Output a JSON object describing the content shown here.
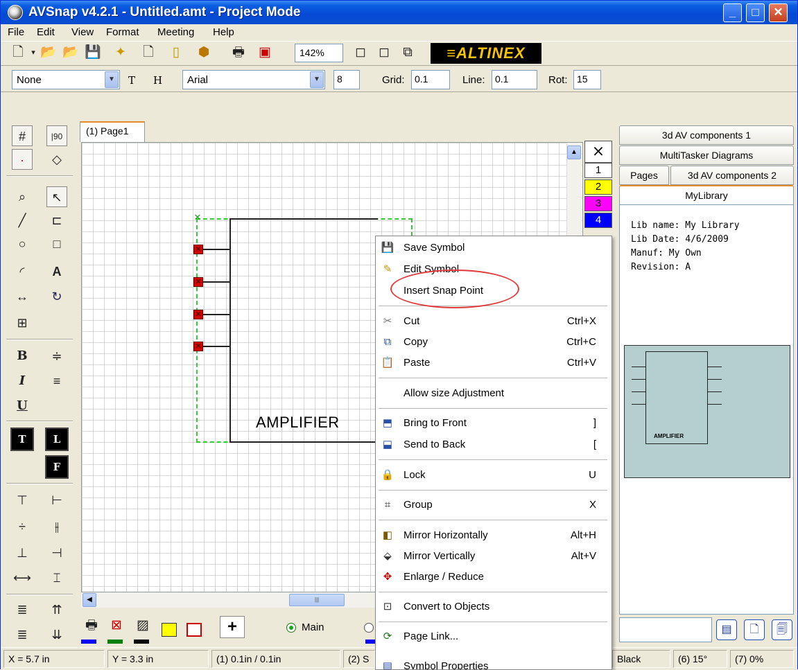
{
  "window": {
    "title": "AVSnap v4.2.1 - Untitled.amt  - Project Mode"
  },
  "menu": [
    "File",
    "Edit",
    "View",
    "Format",
    "Meeting",
    "Help"
  ],
  "toolbar": {
    "zoom": "142%",
    "logo": "≡ALTINEX"
  },
  "format_bar": {
    "style": "None",
    "bold_t": "T",
    "bold_h": "H",
    "font": "Arial",
    "font_size": "8",
    "grid_label": "Grid:",
    "grid_value": "0.1",
    "line_label": "Line:",
    "line_value": "0.1",
    "rot_label": "Rot:",
    "rot_value": "15"
  },
  "left_tools": {
    "angle": "|90",
    "text_a": "A",
    "bold": "B",
    "italic": "I",
    "underline": "U",
    "t": "T",
    "l": "L",
    "f": "F"
  },
  "page_tab": "(1) Page1",
  "canvas": {
    "symbol_label": "AMPLIFIER"
  },
  "layers": [
    "1",
    "2",
    "3",
    "4"
  ],
  "palette": {
    "main_label": "Main",
    "add": "+"
  },
  "status": [
    "X = 5.7 in",
    "Y = 3.3 in",
    "(1) 0.1in / 0.1in",
    "(2) S",
    "Black",
    "(6) 15°",
    "(7) 0%"
  ],
  "right_panel": {
    "tabs": [
      "3d AV components 1",
      "MultiTasker Diagrams",
      "Pages",
      "3d AV components 2",
      "MyLibrary"
    ],
    "lib_name": "Lib name: My Library",
    "lib_date": "Lib Date: 4/6/2009",
    "manuf": "Manuf:  My Own",
    "revision": "Revision: A",
    "preview_label": "AMPLIFIER"
  },
  "context_menu": {
    "items": [
      {
        "label": "Save Symbol",
        "key": "",
        "icon": "floppy-icon"
      },
      {
        "label": "Edit Symbol",
        "key": "",
        "icon": "edit-symbol-icon"
      },
      {
        "label": "Insert Snap Point",
        "key": "",
        "icon": ""
      },
      {
        "label": "Cut",
        "key": "Ctrl+X",
        "icon": "scissors-icon"
      },
      {
        "label": "Copy",
        "key": "Ctrl+C",
        "icon": "copy-icon"
      },
      {
        "label": "Paste",
        "key": "Ctrl+V",
        "icon": "paste-icon"
      },
      {
        "label": "Allow size Adjustment",
        "key": "",
        "icon": ""
      },
      {
        "label": "Bring to Front",
        "key": "]",
        "icon": "bring-front-icon"
      },
      {
        "label": "Send to Back",
        "key": "[",
        "icon": "send-back-icon"
      },
      {
        "label": "Lock",
        "key": "U",
        "icon": "lock-icon"
      },
      {
        "label": "Group",
        "key": "X",
        "icon": "group-icon"
      },
      {
        "label": "Mirror Horizontally",
        "key": "Alt+H",
        "icon": "mirror-h-icon"
      },
      {
        "label": "Mirror Vertically",
        "key": "Alt+V",
        "icon": "mirror-v-icon"
      },
      {
        "label": "Enlarge / Reduce",
        "key": "",
        "icon": "enlarge-icon"
      },
      {
        "label": "Convert to Objects",
        "key": "",
        "icon": "convert-icon"
      },
      {
        "label": "Page Link...",
        "key": "",
        "icon": "page-link-icon"
      },
      {
        "label": "Symbol Properties",
        "key": "",
        "icon": "properties-icon"
      }
    ]
  }
}
